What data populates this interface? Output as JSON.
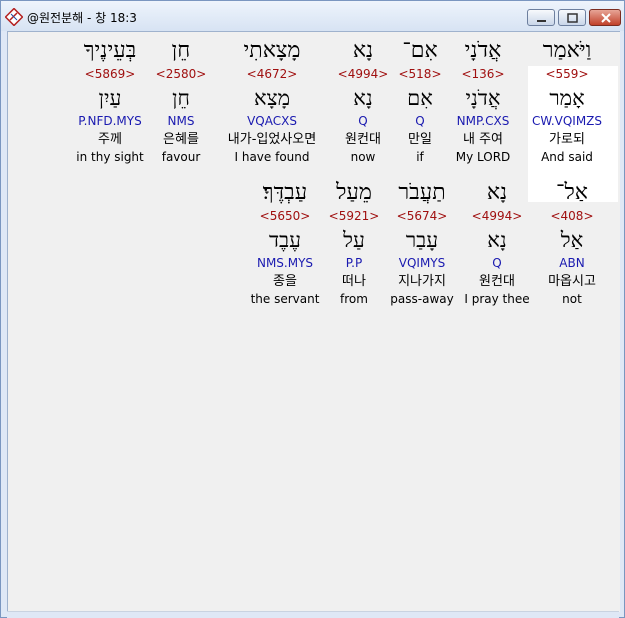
{
  "window": {
    "title": "@원전분해 - 창 18:3",
    "icons": {
      "app": "bible-app-icon",
      "minimize": "minimize-icon",
      "maximize": "maximize-icon",
      "close": "close-icon"
    },
    "colors": {
      "strong": "#a01010",
      "morph": "#1a1ab0",
      "highlight": "#ffffff"
    }
  },
  "row1": [
    {
      "hebrew": "וַיֹּאמַר",
      "strong": "<559>",
      "lexeme": "אָמַר",
      "morph": "CW.VQIMZS",
      "korean": "가로되",
      "english": "And said"
    },
    {
      "hebrew": "אֲדֹנָי",
      "strong": "<136>",
      "lexeme": "אֲדֹנָי",
      "morph": "NMP.CXS",
      "korean": "내 주여",
      "english": "My LORD"
    },
    {
      "hebrew": "אִם־",
      "strong": "<518>",
      "lexeme": "אִם",
      "morph": "Q",
      "korean": "만일",
      "english": "if"
    },
    {
      "hebrew": "נָא",
      "strong": "<4994>",
      "lexeme": "נָא",
      "morph": "Q",
      "korean": "원컨대",
      "english": "now"
    },
    {
      "hebrew": "מָצָאתִי",
      "strong": "<4672>",
      "lexeme": "מָצָא",
      "morph": "VQACXS",
      "korean": "내가-입었사오면",
      "english": "I have found"
    },
    {
      "hebrew": "חֵן",
      "strong": "<2580>",
      "lexeme": "חֵן",
      "morph": "NMS",
      "korean": "은혜를",
      "english": "favour"
    },
    {
      "hebrew": "בְּעֵינֶיךָ",
      "strong": "<5869>",
      "lexeme": "עַיִן",
      "morph": "P.NFD.MYS",
      "korean": "주께",
      "english": "in thy sight"
    }
  ],
  "row2": [
    {
      "hebrew": "אַל־",
      "strong": "<408>",
      "lexeme": "אַל",
      "morph": "ABN",
      "korean": "마옵시고",
      "english": "not"
    },
    {
      "hebrew": "נָא",
      "strong": "<4994>",
      "lexeme": "נָא",
      "morph": "Q",
      "korean": "원컨대",
      "english": "I pray thee"
    },
    {
      "hebrew": "תַעֲבֹר",
      "strong": "<5674>",
      "lexeme": "עָבַר",
      "morph": "VQIMYS",
      "korean": "지나가지",
      "english": "pass-away"
    },
    {
      "hebrew": "מֵעַל",
      "strong": "<5921>",
      "lexeme": "עַל",
      "morph": "P.P",
      "korean": "떠나",
      "english": "from"
    },
    {
      "hebrew": "עַבְדֶּךָ׃",
      "strong": "<5650>",
      "lexeme": "עֶבֶד",
      "morph": "NMS.MYS",
      "korean": "종을",
      "english": "the servant"
    }
  ]
}
